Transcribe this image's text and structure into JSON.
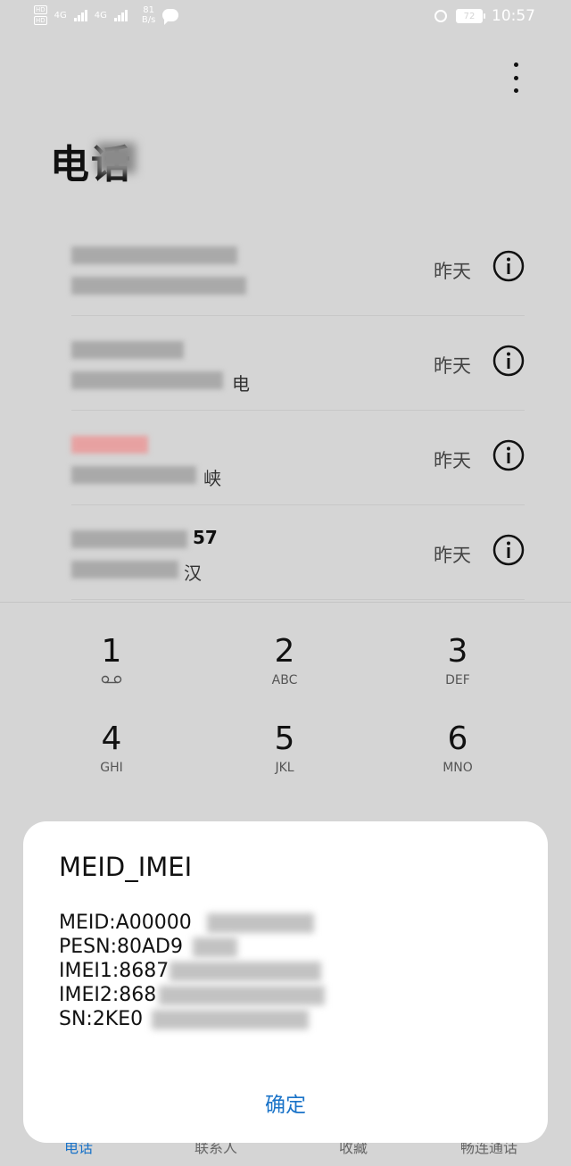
{
  "status_bar": {
    "network_type_1": "4G",
    "network_type_2": "4G",
    "hd_label": "HD",
    "net_speed_value": "81",
    "net_speed_unit": "B/s",
    "battery": "72",
    "time": "10:57",
    "icons": [
      "hd-icon",
      "signal-icon",
      "chat-icon",
      "alarm-icon",
      "battery-icon"
    ]
  },
  "header": {
    "title": "电话",
    "menu_icon": "more-vert-icon"
  },
  "calls": [
    {
      "visible_fragment": "",
      "time": "昨天",
      "highlight": "none"
    },
    {
      "visible_fragment": "电",
      "time": "昨天",
      "highlight": "none"
    },
    {
      "visible_fragment": "峡",
      "time": "昨天",
      "highlight": "red"
    },
    {
      "visible_fragment": "57",
      "visible_fragment_2": "汉",
      "time": "昨天",
      "highlight": "none"
    }
  ],
  "keypad": [
    {
      "digit": "1",
      "letters": "",
      "icon": "voicemail-icon"
    },
    {
      "digit": "2",
      "letters": "ABC"
    },
    {
      "digit": "3",
      "letters": "DEF"
    },
    {
      "digit": "4",
      "letters": "GHI"
    },
    {
      "digit": "5",
      "letters": "JKL"
    },
    {
      "digit": "6",
      "letters": "MNO"
    }
  ],
  "dialog": {
    "title": "MEID_IMEI",
    "lines": [
      {
        "label": "MEID:",
        "visible": "A00000"
      },
      {
        "label": "PESN:",
        "visible": "80AD9"
      },
      {
        "label": "IMEI1:",
        "visible": "8687"
      },
      {
        "label": "IMEI2:",
        "visible": "868"
      },
      {
        "label": "SN:",
        "visible": "2KE0"
      }
    ],
    "confirm_label": "确定"
  },
  "bottom_nav": {
    "items": [
      "电话",
      "联系人",
      "收藏",
      "畅连通话"
    ],
    "active": "电话"
  },
  "colors": {
    "accent": "#1a73c8",
    "dim_background": "#d5d5d5",
    "dialog_bg": "#ffffff"
  }
}
